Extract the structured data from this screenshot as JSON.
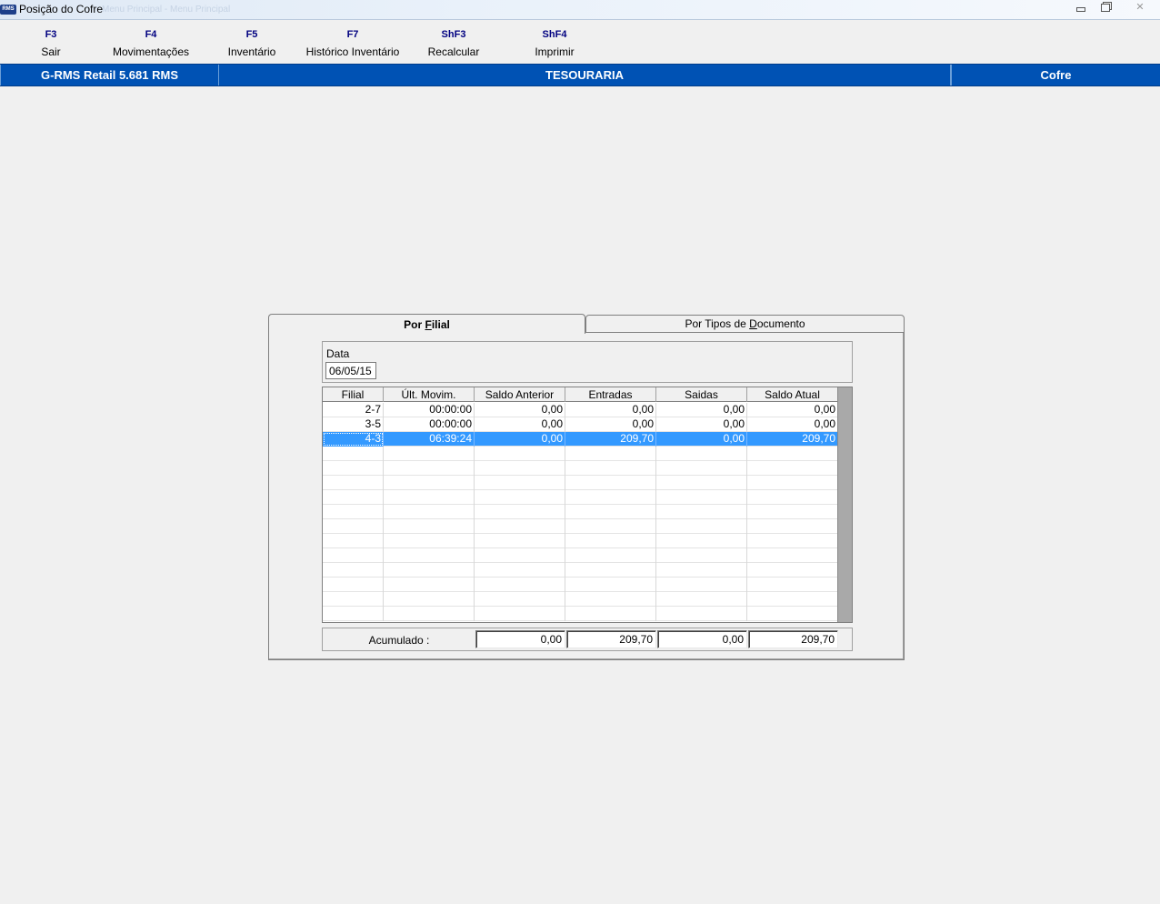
{
  "window": {
    "logo_text": "RMS",
    "title": "Posição do Cofre",
    "ghost_text": "Menu Principal - Menu Principal"
  },
  "toolbar": [
    {
      "key": "F3",
      "label": "Sair"
    },
    {
      "key": "F4",
      "label": "Movimentações"
    },
    {
      "key": "F5",
      "label": "Inventário"
    },
    {
      "key": "F7",
      "label": "Histórico Inventário"
    },
    {
      "key": "ShF3",
      "label": "Recalcular"
    },
    {
      "key": "ShF4",
      "label": "Imprimir"
    }
  ],
  "band": {
    "system": "G-RMS Retail 5.681 RMS",
    "module": "TESOURARIA",
    "screen": "Cofre",
    "color": "#0052b4"
  },
  "tabs": {
    "active_pre": "Por ",
    "active_u": "F",
    "active_post": "ilial",
    "inactive_pre": "Por Tipos de ",
    "inactive_u": "D",
    "inactive_post": "ocumento"
  },
  "date": {
    "label": "Data",
    "value": "06/05/15"
  },
  "grid": {
    "columns": [
      "Filial",
      "Últ. Movim.",
      "Saldo Anterior",
      "Entradas",
      "Saidas",
      "Saldo Atual"
    ],
    "rows": [
      [
        "2-7",
        "00:00:00",
        "0,00",
        "0,00",
        "0,00",
        "0,00"
      ],
      [
        "3-5",
        "00:00:00",
        "0,00",
        "0,00",
        "0,00",
        "0,00"
      ],
      [
        "4-3",
        "06:39:24",
        "0,00",
        "209,70",
        "0,00",
        "209,70"
      ]
    ],
    "selected_row": 2,
    "selection_color": "#3399ff"
  },
  "accum": {
    "label": "Acumulado :",
    "values": [
      "0,00",
      "209,70",
      "0,00",
      "209,70"
    ]
  }
}
